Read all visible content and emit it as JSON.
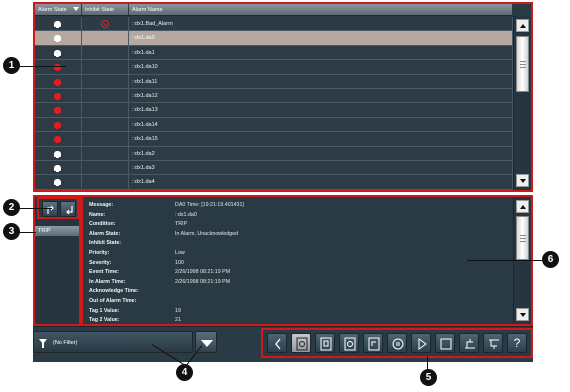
{
  "alarm_table": {
    "columns": [
      "Alarm State",
      "Inhibit State",
      "Alarm Name"
    ],
    "rows": [
      {
        "name": "::dx1.Bad_Alarm",
        "state": "white",
        "inhibited": true
      },
      {
        "name": "::dx1.da0",
        "state": "white",
        "selected": true
      },
      {
        "name": "::dx1.da1",
        "state": "white"
      },
      {
        "name": "::dx1.da10",
        "state": "red"
      },
      {
        "name": "::dx1.da11",
        "state": "red"
      },
      {
        "name": "::dx1.da12",
        "state": "red"
      },
      {
        "name": "::dx1.da13",
        "state": "red"
      },
      {
        "name": "::dx1.da14",
        "state": "red"
      },
      {
        "name": "::dx1.da15",
        "state": "red"
      },
      {
        "name": "::dx1.da2",
        "state": "white"
      },
      {
        "name": "::dx1.da3",
        "state": "white"
      },
      {
        "name": "::dx1.da4",
        "state": "white"
      }
    ]
  },
  "alarm_list": {
    "item": "TRIP"
  },
  "details": [
    {
      "label": "Message:",
      "value": "DA0 Time: [19:21:19.401431]"
    },
    {
      "label": "Name:",
      "value": "::dx1.da0"
    },
    {
      "label": "Condition:",
      "value": "TRIP"
    },
    {
      "label": "Alarm State:",
      "value": "In Alarm, Unacknowledged"
    },
    {
      "label": "Inhibit State:",
      "value": ""
    },
    {
      "label": "Priority:",
      "value": "Low"
    },
    {
      "label": "Severity:",
      "value": "100"
    },
    {
      "label": "Event Time:",
      "value": "2/26/1998 08:21:19 PM"
    },
    {
      "label": "In Alarm Time:",
      "value": "2/26/1998 08:21:19 PM"
    },
    {
      "label": "Acknowledge Time:",
      "value": ""
    },
    {
      "label": "Out of Alarm Time:",
      "value": ""
    },
    {
      "label": "Tag 1 Value:",
      "value": "19"
    },
    {
      "label": "Tag 2 Value:",
      "value": "21"
    }
  ],
  "filter": {
    "text": "(No Filter)"
  },
  "toolbar": {
    "icons": [
      "chevron-left-icon",
      "details-icon",
      "acknowledge-icon",
      "acknowledge-page-icon",
      "acknowledge-all-icon",
      "reset-icon",
      "play-icon",
      "stop-icon",
      "suppress-icon",
      "unsuppress-icon",
      "help-icon"
    ],
    "help_label": "?"
  },
  "callouts": [
    "1",
    "2",
    "3",
    "4",
    "5",
    "6"
  ],
  "colors": {
    "callout_frame": "#d01a1a",
    "alarm_red": "#e02020",
    "panel": "#2a3a44"
  }
}
